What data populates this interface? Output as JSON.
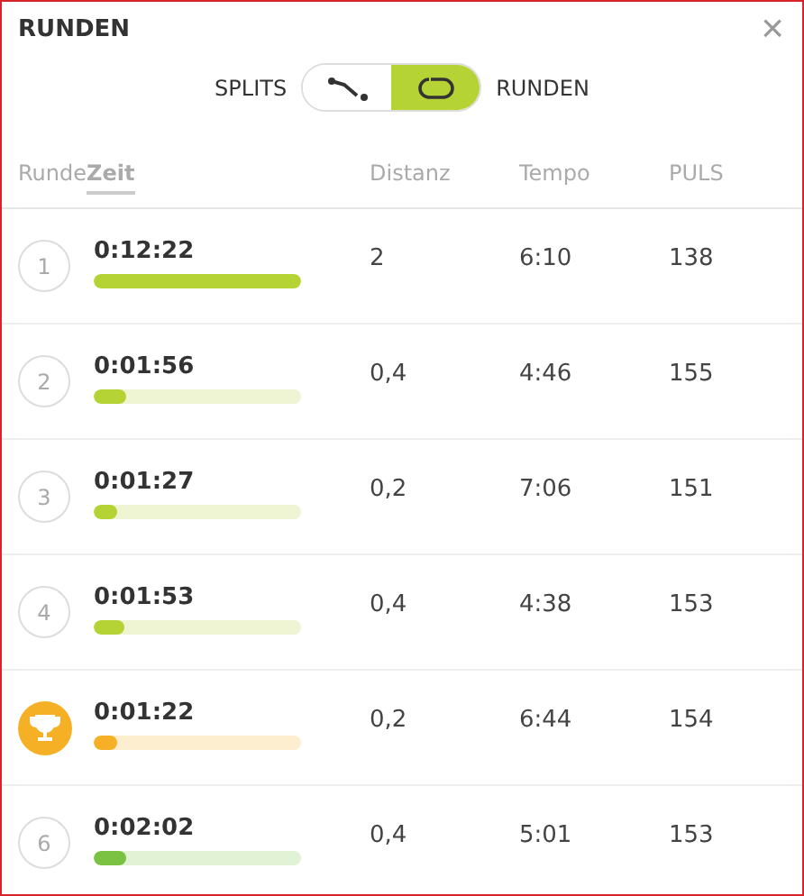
{
  "title": "RUNDEN",
  "close": "×",
  "toggle": {
    "options": [
      {
        "label": "SPLITS",
        "kind": "splits",
        "selected": false
      },
      {
        "label": "RUNDEN",
        "kind": "laps",
        "selected": true
      }
    ]
  },
  "columns": [
    {
      "label": "Runde",
      "selected": false
    },
    {
      "label": "Zeit",
      "selected": true
    },
    {
      "label": "Distanz",
      "selected": false
    },
    {
      "label": "Tempo",
      "selected": false
    },
    {
      "label": "PULS",
      "selected": false
    }
  ],
  "rows": [
    {
      "kind": "lap",
      "lap": "1",
      "time": "0:12:22",
      "level": 1,
      "color": "#b5d334",
      "distance": "2",
      "pace": "6:10",
      "pulse": "138"
    },
    {
      "kind": "lap",
      "lap": "2",
      "time": "0:01:56",
      "level": 0.16,
      "color": "#b5d334",
      "distance": "0,4",
      "pace": "4:46",
      "pulse": "155"
    },
    {
      "kind": "lap",
      "lap": "3",
      "time": "0:01:27",
      "level": 0.11,
      "color": "#b5d334",
      "distance": "0,2",
      "pace": "7:06",
      "pulse": "151"
    },
    {
      "kind": "lap",
      "lap": "4",
      "time": "0:01:53",
      "level": 0.15,
      "color": "#b5d334",
      "distance": "0,4",
      "pace": "4:38",
      "pulse": "153"
    },
    {
      "kind": "best",
      "time": "0:01:22",
      "level": 0.11,
      "color": "#f5b026",
      "distance": "0,2",
      "pace": "6:44",
      "pulse": "154"
    },
    {
      "kind": "lap",
      "lap": "6",
      "time": "0:02:02",
      "level": 0.16,
      "color": "#7cc242",
      "distance": "0,4",
      "pace": "5:01",
      "pulse": "153"
    }
  ]
}
